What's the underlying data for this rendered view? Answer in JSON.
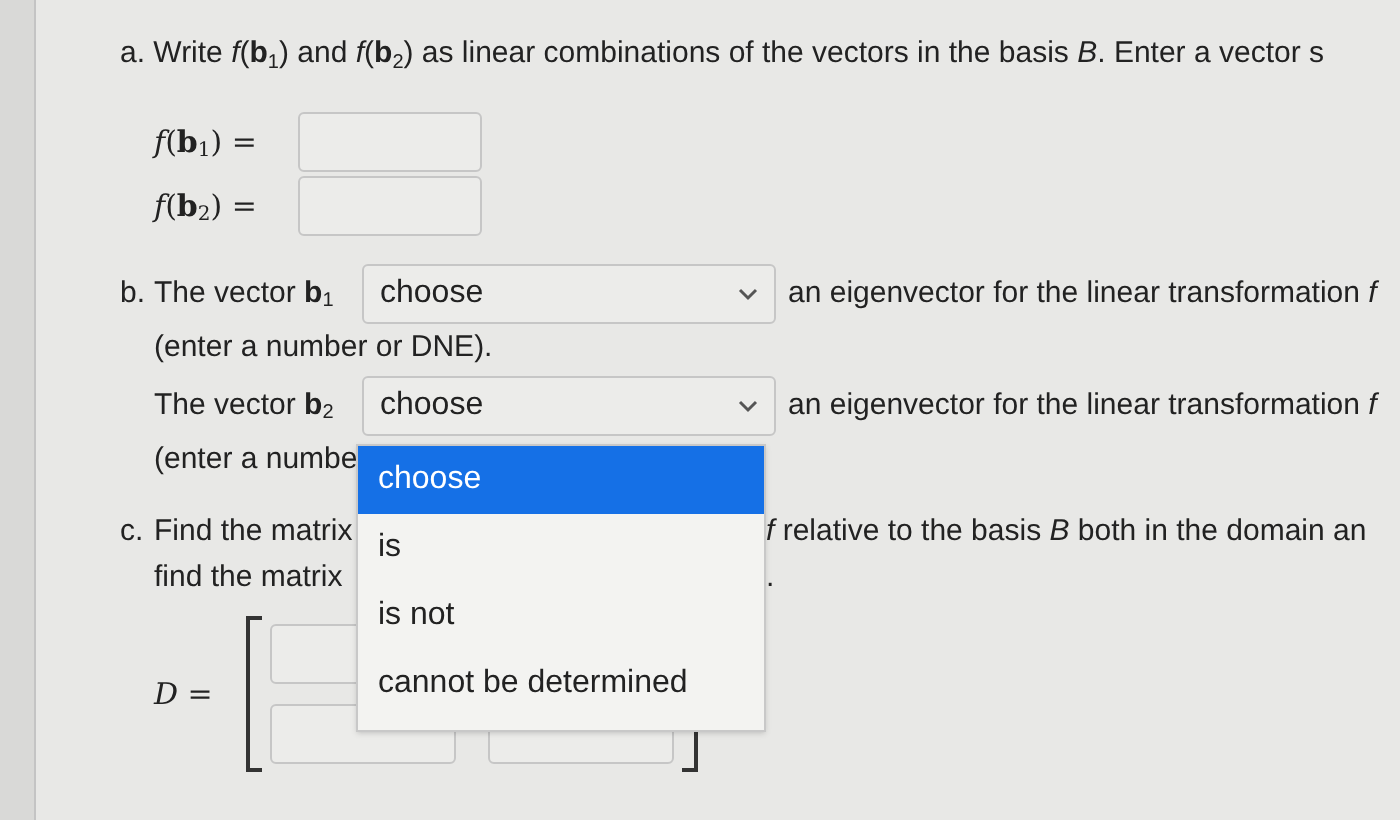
{
  "part_a": {
    "prompt": "a. Write *f*(**b**$_{1}$) and *f*(**b**$_{2}$) as linear combinations of the vectors in the basis *B*. Enter a vector s",
    "fields": [
      {
        "label": "*f*(**b**$_{1}$) ="
      },
      {
        "label": "*f*(**b**$_{2}$) ="
      }
    ]
  },
  "part_b": {
    "rows": [
      {
        "marker": "b.",
        "label": "The vector **b**$_{1}$",
        "select": "choose",
        "after": "an eigenvector for the linear transformation *f*",
        "note": "(enter a number or DNE)."
      },
      {
        "label": "The vector **b**$_{2}$",
        "select": "choose",
        "after": "an eigenvector for the linear transformation *f*",
        "note": "(enter a numbe"
      }
    ]
  },
  "dropdown": {
    "options": [
      {
        "label": "choose",
        "selected": true
      },
      {
        "label": "is",
        "selected": false
      },
      {
        "label": "is not",
        "selected": false
      },
      {
        "label": "cannot be determined",
        "selected": false
      }
    ]
  },
  "part_c": {
    "marker": "c.",
    "line1_left": "Find the matrix",
    "line1_right": "*f* relative to the basis *B* both in the domain an",
    "line2_left": "find the matrix",
    "line2_right": "."
  },
  "matrix": {
    "label": "*D* ="
  }
}
